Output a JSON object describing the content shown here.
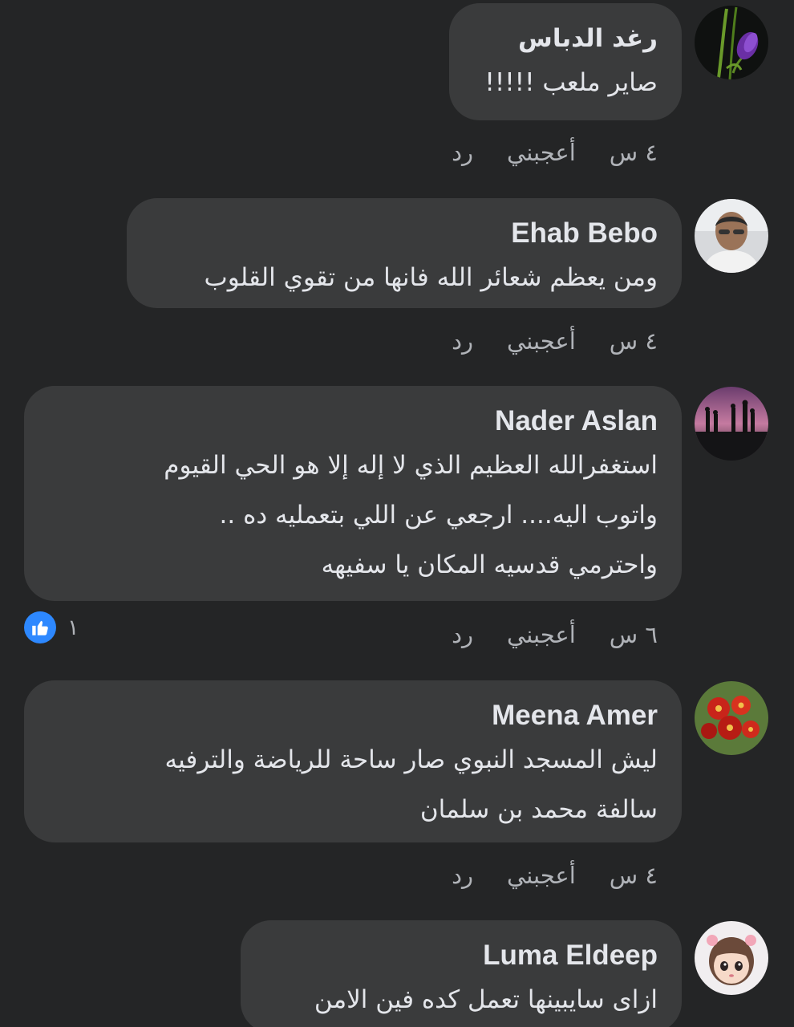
{
  "comments": [
    {
      "author": "رغد الدباس",
      "text": "صاير ملعب !!!!!",
      "time": "٤ س",
      "like_label": "أعجبني",
      "reply_label": "رد",
      "avatar": "purple-tulip-avatar"
    },
    {
      "author": "Ehab Bebo",
      "text": "ومن يعظم شعائر الله فانها من تقوي القلوب",
      "time": "٤ س",
      "like_label": "أعجبني",
      "reply_label": "رد",
      "avatar": "man-portrait-avatar"
    },
    {
      "author": "Nader Aslan",
      "text": "استغفرالله العظيم الذي لا إله إلا هو الحي القيوم\nواتوب اليه.... ارجعي عن اللي بتعمليه ده ..\nواحترمي قدسيه المكان يا سفيهه",
      "time": "٦ س",
      "like_label": "أعجبني",
      "reply_label": "رد",
      "reaction_count": "١",
      "reaction_icon": "thumbs-up-icon",
      "avatar": "silhouettes-sunset-avatar"
    },
    {
      "author": "Meena Amer",
      "text": "ليش المسجد النبوي صار ساحة للرياضة والترفيه\nسالفة محمد بن سلمان",
      "time": "٤ س",
      "like_label": "أعجبني",
      "reply_label": "رد",
      "avatar": "red-flowers-avatar"
    },
    {
      "author": "Luma Eldeep",
      "text": "ازاى سايبينها تعمل كده فين الامن",
      "avatar": "cartoon-girl-avatar"
    }
  ],
  "colors": {
    "background": "#242526",
    "bubble": "#3a3b3c",
    "primary_text": "#e4e6eb",
    "secondary_text": "#b0b3b8",
    "like_blue": "#2d88ff"
  }
}
